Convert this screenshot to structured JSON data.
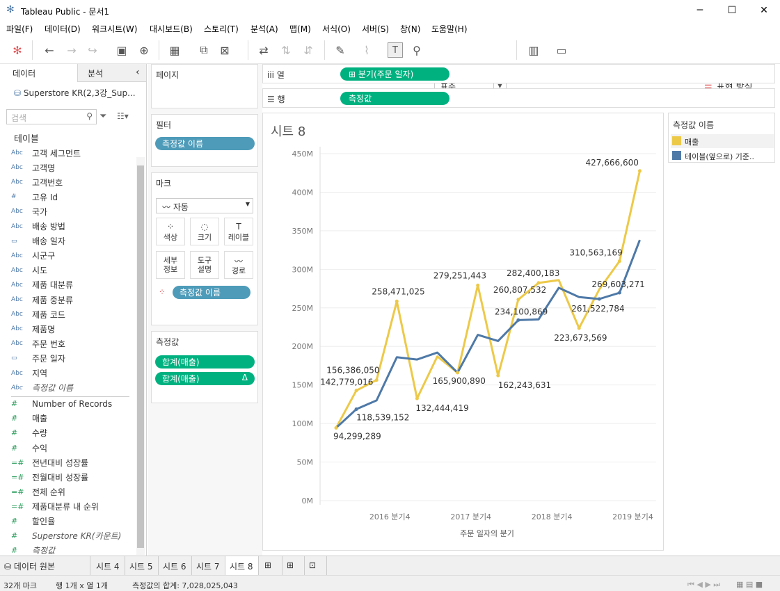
{
  "window": {
    "title": "Tableau Public - 문서1",
    "minimize": "─",
    "maximize": "☐",
    "close": "✕"
  },
  "menu": [
    "파일(F)",
    "데이터(D)",
    "워크시트(W)",
    "대시보드(B)",
    "스토리(T)",
    "분석(A)",
    "맵(M)",
    "서식(O)",
    "서버(S)",
    "창(N)",
    "도움말(H)"
  ],
  "toolbar": {
    "fit": "표준",
    "show_me": "표현 방식"
  },
  "left": {
    "tab_data": "데이터",
    "tab_analytics": "분석",
    "collapse": "‹",
    "datasource": "Superstore KR(2,3강_Sup...",
    "search_placeholder": "검색",
    "tables_heading": "테이블",
    "dimensions": [
      {
        "type": "Abc",
        "name": "고객 세그먼트"
      },
      {
        "type": "Abc",
        "name": "고객명"
      },
      {
        "type": "Abc",
        "name": "고객번호"
      },
      {
        "type": "#",
        "name": "고유 Id"
      },
      {
        "type": "Abc",
        "name": "국가"
      },
      {
        "type": "Abc",
        "name": "배송 방법"
      },
      {
        "type": "▭",
        "name": "배송 일자"
      },
      {
        "type": "Abc",
        "name": "시군구"
      },
      {
        "type": "Abc",
        "name": "시도"
      },
      {
        "type": "Abc",
        "name": "제품 대분류"
      },
      {
        "type": "Abc",
        "name": "제품 중분류"
      },
      {
        "type": "Abc",
        "name": "제품 코드"
      },
      {
        "type": "Abc",
        "name": "제품명"
      },
      {
        "type": "Abc",
        "name": "주문 번호"
      },
      {
        "type": "▭",
        "name": "주문 일자"
      },
      {
        "type": "Abc",
        "name": "지역"
      },
      {
        "type": "Abc",
        "name": "측정값 이름"
      }
    ],
    "measures": [
      {
        "type": "#",
        "name": "Number of Records"
      },
      {
        "type": "#",
        "name": "매출"
      },
      {
        "type": "#",
        "name": "수량"
      },
      {
        "type": "#",
        "name": "수익"
      },
      {
        "type": "=#",
        "name": "전년대비 성장률"
      },
      {
        "type": "=#",
        "name": "전월대비 성장률"
      },
      {
        "type": "=#",
        "name": "전체 순위"
      },
      {
        "type": "=#",
        "name": "제품대분류 내 순위"
      },
      {
        "type": "#",
        "name": "할인율"
      },
      {
        "type": "#",
        "name": "Superstore KR(카운트)"
      },
      {
        "type": "#",
        "name": "측정값"
      }
    ]
  },
  "shelves": {
    "pages": "페이지",
    "filters": "필터",
    "filter_pill": "측정값 이름",
    "marks": "마크",
    "mark_type": "자동",
    "mark_buttons": [
      {
        "label": "색상",
        "icon": "⁘"
      },
      {
        "label": "크기",
        "icon": "◌"
      },
      {
        "label": "레이블",
        "icon": "T"
      },
      {
        "label": "세부\n정보",
        "icon": ""
      },
      {
        "label": "도구\n설명",
        "icon": ""
      },
      {
        "label": "경로",
        "icon": "〰"
      }
    ],
    "color_pill": "측정값 이름",
    "measure_values": "측정값",
    "mv_pills": [
      "합계(매출)",
      "합계(매출)"
    ],
    "delta": "Δ",
    "columns_label": "열",
    "columns_pill": "분기(주문 일자)",
    "rows_label": "행",
    "rows_pill": "측정값"
  },
  "legend": {
    "title": "측정값 이름",
    "items": [
      {
        "label": "매출",
        "color": "#edc948"
      },
      {
        "label": "테이블(옆으로) 기준..",
        "color": "#4e79a7"
      }
    ]
  },
  "chart_data": {
    "type": "line",
    "title": "시트 8",
    "xlabel": "주문 일자의 분기",
    "ylabel": "",
    "x": [
      "2016 Q1",
      "2016 Q2",
      "2016 Q3",
      "2016 Q4",
      "2017 Q1",
      "2017 Q2",
      "2017 Q3",
      "2017 Q4",
      "2018 Q1",
      "2018 Q2",
      "2018 Q3",
      "2018 Q4",
      "2019 Q1",
      "2019 Q2",
      "2019 Q3",
      "2019 Q4"
    ],
    "x_ticks": [
      {
        "i": 3,
        "label": "2016 분기4"
      },
      {
        "i": 7,
        "label": "2017 분기4"
      },
      {
        "i": 11,
        "label": "2018 분기4"
      },
      {
        "i": 15,
        "label": "2019 분기4"
      }
    ],
    "ylim": [
      0,
      450000000
    ],
    "y_ticks": [
      "0M",
      "50M",
      "100M",
      "150M",
      "200M",
      "250M",
      "300M",
      "350M",
      "400M",
      "450M"
    ],
    "series": [
      {
        "name": "매출",
        "color": "#edc948",
        "values": [
          94299289,
          142779016,
          156386050,
          258471025,
          132444419,
          187000000,
          165900890,
          279251443,
          162243631,
          260807532,
          282400183,
          286000000,
          223673569,
          274000000,
          310563169,
          427666600
        ]
      },
      {
        "name": "테이블(옆으로) 기준..",
        "color": "#4e79a7",
        "values": [
          94299289,
          118539152,
          130000000,
          186000000,
          183000000,
          192000000,
          165900890,
          215000000,
          207000000,
          234100869,
          235000000,
          276000000,
          264000000,
          261522784,
          269603271,
          338000000
        ]
      }
    ],
    "labels": [
      {
        "s": 0,
        "i": 0,
        "text": "94,299,289",
        "dx": -4,
        "dy": 16
      },
      {
        "s": 0,
        "i": 1,
        "text": "142,779,016",
        "dx": -52,
        "dy": -8
      },
      {
        "s": 0,
        "i": 2,
        "text": "156,386,050",
        "dx": -72,
        "dy": -10
      },
      {
        "s": 0,
        "i": 3,
        "text": "258,471,025",
        "dx": -36,
        "dy": -10
      },
      {
        "s": 0,
        "i": 4,
        "text": "132,444,419",
        "dx": -2,
        "dy": 18
      },
      {
        "s": 0,
        "i": 6,
        "text": "165,900,890",
        "dx": -36,
        "dy": 16
      },
      {
        "s": 0,
        "i": 7,
        "text": "279,251,443",
        "dx": -64,
        "dy": -10
      },
      {
        "s": 0,
        "i": 8,
        "text": "162,243,631",
        "dx": 0,
        "dy": 18
      },
      {
        "s": 0,
        "i": 9,
        "text": "260,807,532",
        "dx": -36,
        "dy": -10
      },
      {
        "s": 0,
        "i": 10,
        "text": "282,400,183",
        "dx": -46,
        "dy": -10
      },
      {
        "s": 0,
        "i": 12,
        "text": "223,673,569",
        "dx": -36,
        "dy": 18
      },
      {
        "s": 0,
        "i": 14,
        "text": "310,563,169",
        "dx": -72,
        "dy": -8
      },
      {
        "s": 0,
        "i": 15,
        "text": "427,666,600",
        "dx": -78,
        "dy": -8
      },
      {
        "s": 1,
        "i": 1,
        "text": "118,539,152",
        "dx": 0,
        "dy": 16
      },
      {
        "s": 1,
        "i": 9,
        "text": "234,100,869",
        "dx": -34,
        "dy": -8
      },
      {
        "s": 1,
        "i": 13,
        "text": "261,522,784",
        "dx": -40,
        "dy": 18
      },
      {
        "s": 1,
        "i": 14,
        "text": "269,603,271",
        "dx": -40,
        "dy": -8
      }
    ],
    "grid": "horizontal"
  },
  "bottom": {
    "datasource_tab": "데이터 원본",
    "sheets": [
      "시트 4",
      "시트 5",
      "시트 6",
      "시트 7",
      "시트 8"
    ],
    "active_sheet": "시트 8"
  },
  "status": {
    "marks": "32개 마크",
    "rows_cols": "행 1개 x 열 1개",
    "sum": "측정값의 합계: 7,028,025,043"
  }
}
